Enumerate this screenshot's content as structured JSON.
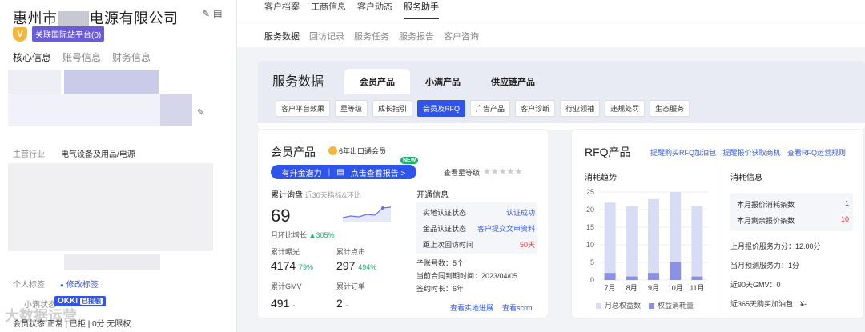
{
  "company": {
    "name_prefix": "惠州市",
    "name_suffix": "电源有限公司",
    "medal": "V",
    "intl_tag": "关联国际站平台(0)"
  },
  "left_tabs": [
    "核心信息",
    "账号信息",
    "财务信息"
  ],
  "main_industry": {
    "label": "主营行业",
    "value": "电气设备及用品/电源"
  },
  "personal_tag": {
    "label": "个人标签",
    "action": "修改标签"
  },
  "okki": {
    "label": "小满状态",
    "logo": "OKKI",
    "status": "已接触"
  },
  "bottom_row": "会员状态 正常 | 已拒 | 0分 无限权",
  "watermark": "大数据运营",
  "top_tabs": [
    "客户档案",
    "工商信息",
    "客户动态",
    "服务助手"
  ],
  "sub_tabs": [
    "服务数据",
    "回访记录",
    "服务任务",
    "服务报告",
    "客户咨询"
  ],
  "main": {
    "title": "服务数据",
    "product_tabs": [
      "会员产品",
      "小满产品",
      "供应链产品"
    ],
    "chips": [
      "客户平台效果",
      "星等级",
      "成长指引",
      "会员及RFQ",
      "广告产品",
      "客户诊断",
      "行业领袖",
      "违规处罚",
      "生态服务"
    ]
  },
  "member": {
    "title": "会员产品",
    "years_badge": "6年出口通会员",
    "bar_left": "有升金潜力",
    "bar_right": "点击查看报告 >",
    "new_flag": "NEW",
    "star_link": "查看星等级",
    "inquiry_label": "累计询盘",
    "inquiry_sub": "近30天指标&环比",
    "inquiry_value": "69",
    "mom_label": "月环比增长",
    "mom_value": "305%",
    "exposure_label": "累计曝光",
    "exposure_value": "4174",
    "exposure_pct": "79%",
    "clicks_label": "累计点击",
    "clicks_value": "297",
    "clicks_pct": "494%",
    "gmv_label": "累计GMV",
    "gmv_value": "491",
    "gmv_suffix": "-",
    "orders_label": "累计订单",
    "orders_value": "2",
    "orders_suffix": "-",
    "open_title": "开通信息",
    "rows": [
      {
        "label": "实地认证状态",
        "value": "认证成功"
      },
      {
        "label": "金品认证状态",
        "value": "客户提交文审资料"
      },
      {
        "label": "距上次回访时间",
        "value": "50天"
      }
    ],
    "sub_accounts": "子账号数：5个",
    "contract_expiry": "当前合同到期时间：2023/04/05",
    "sign_length": "签约时长：6年",
    "link_onsite": "查看实地进展",
    "link_crm": "查看scrm"
  },
  "rfq": {
    "title": "RFQ产品",
    "links": [
      "提醒购买RFQ加油包",
      "提醒报价获取商机",
      "查看RFQ运营规则"
    ],
    "trend_title": "消耗趋势",
    "info_title": "消耗信息",
    "quota_rows": [
      {
        "label": "本月报价消耗条数",
        "value": "1"
      },
      {
        "label": "本月剩余报价条数",
        "value": "10"
      }
    ],
    "score_last": "上月报价服务力分：12.00分",
    "score_pred": "当月预测服务力：1分",
    "gmv90": "近90天GMV：0",
    "fuel365": "近365天购买加油包：¥-",
    "legend": [
      "月总权益数",
      "权益消耗量"
    ]
  },
  "chart_data": {
    "type": "bar",
    "categories": [
      "7月",
      "8月",
      "9月",
      "10月",
      "11月"
    ],
    "series": [
      {
        "name": "月总权益数",
        "values": [
          22,
          21,
          23,
          25,
          21
        ]
      },
      {
        "name": "权益消耗量",
        "values": [
          2,
          1,
          2,
          5,
          1
        ]
      }
    ],
    "ylim": [
      0,
      25
    ],
    "yticks": [
      "0",
      "5",
      "10",
      "15",
      "20",
      "25"
    ],
    "colors": {
      "total": "#d8dcf5",
      "used": "#8a92e6"
    }
  }
}
